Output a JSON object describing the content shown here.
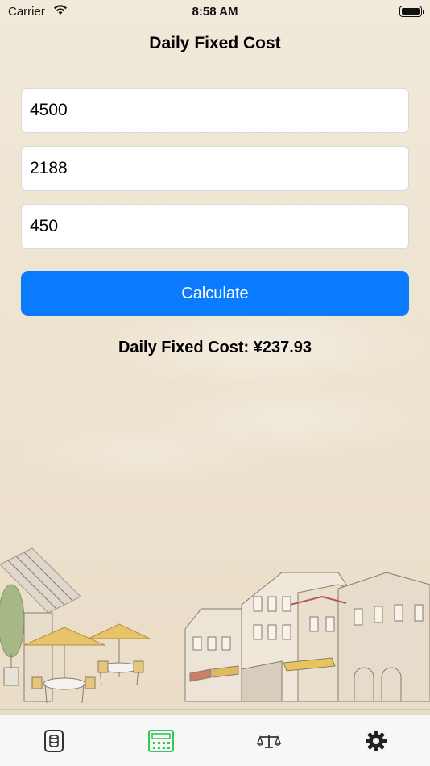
{
  "status_bar": {
    "carrier": "Carrier",
    "time": "8:58 AM"
  },
  "page": {
    "title": "Daily Fixed Cost"
  },
  "form": {
    "fields": [
      {
        "value": "4500"
      },
      {
        "value": "2188"
      },
      {
        "value": "450"
      }
    ],
    "calculate_label": "Calculate"
  },
  "result": {
    "text": "Daily Fixed Cost: ¥237.93"
  },
  "tab_bar": {
    "items": [
      {
        "icon": "database-icon",
        "selected": false
      },
      {
        "icon": "calculator-icon",
        "selected": true
      },
      {
        "icon": "scale-icon",
        "selected": false
      },
      {
        "icon": "gear-icon",
        "selected": false
      }
    ]
  },
  "colors": {
    "accent": "#0A7AFF",
    "selected_tab": "#34C759",
    "tab_icon": "#333333"
  }
}
